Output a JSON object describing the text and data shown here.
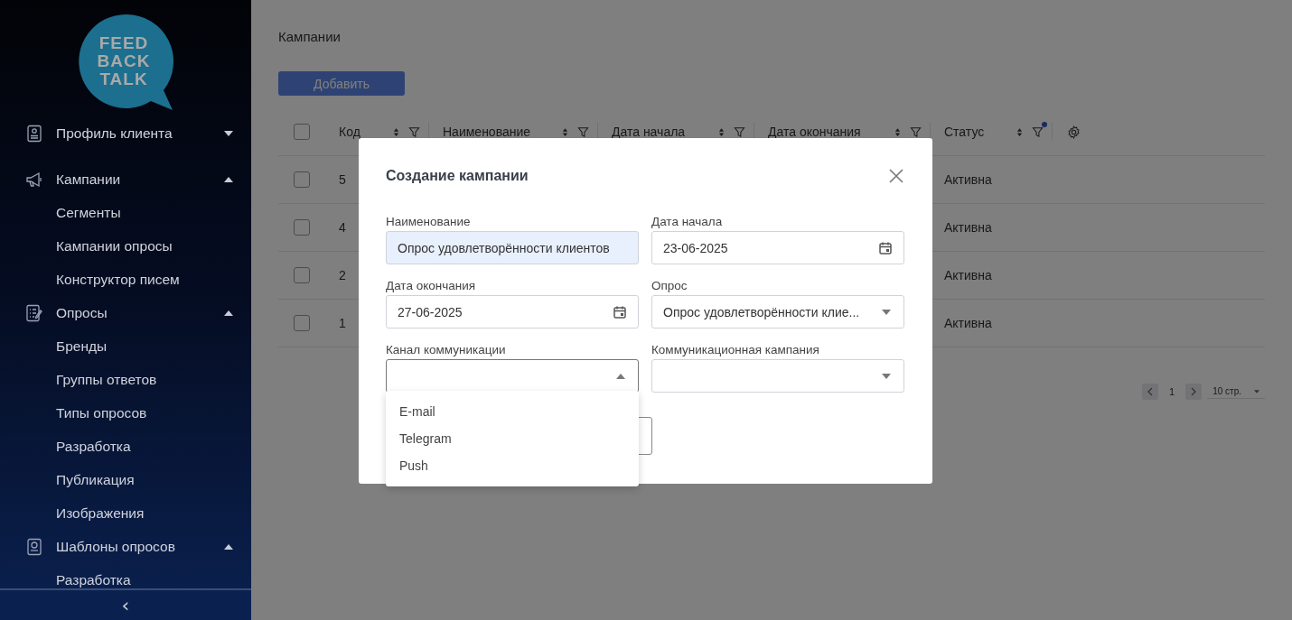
{
  "sidebar": {
    "logo": [
      "FEED",
      "BACK",
      "TALK"
    ],
    "menu": [
      {
        "label": "Профиль клиента",
        "expanded": false
      },
      {
        "label": "Кампании",
        "expanded": true,
        "children": [
          {
            "label": "Сегменты"
          },
          {
            "label": "Кампании опросы"
          },
          {
            "label": "Конструктор писем"
          }
        ]
      },
      {
        "label": "Опросы",
        "expanded": true,
        "children": [
          {
            "label": "Бренды"
          },
          {
            "label": "Группы ответов"
          },
          {
            "label": "Типы опросов"
          },
          {
            "label": "Разработка"
          },
          {
            "label": "Публикация"
          },
          {
            "label": "Изображения"
          }
        ]
      },
      {
        "label": "Шаблоны опросов",
        "expanded": true,
        "children": [
          {
            "label": "Разработка"
          }
        ]
      }
    ],
    "collapse": "‹"
  },
  "page": {
    "title": "Кампании",
    "add_button": "Добавить"
  },
  "table": {
    "all_checked": false,
    "columns": [
      {
        "label": "Код",
        "filtered": false
      },
      {
        "label": "Наименование",
        "filtered": false
      },
      {
        "label": "Дата начала",
        "filtered": false
      },
      {
        "label": "Дата окончания",
        "filtered": false
      },
      {
        "label": "Статус",
        "filtered": true
      }
    ],
    "rows": [
      {
        "code": "5",
        "status": "Активна",
        "checked": false
      },
      {
        "code": "4",
        "status": "Активна",
        "checked": false
      },
      {
        "code": "2",
        "status": "Активна",
        "checked": false
      },
      {
        "code": "1",
        "status": "Активна",
        "checked": false
      }
    ]
  },
  "pagination": {
    "page": "1",
    "page_size": "10 стр."
  },
  "modal": {
    "title": "Создание кампании",
    "fields": [
      {
        "label": "Наименование",
        "kind": "text",
        "value": "Опрос удовлетворённости клиентов",
        "autofilled": true
      },
      {
        "label": "Дата начала",
        "kind": "date",
        "value": "23-06-2025"
      },
      {
        "label": "Дата окончания",
        "kind": "date",
        "value": "27-06-2025"
      },
      {
        "label": "Опрос",
        "kind": "select",
        "value": "Опрос удовлетворённости клие...",
        "open": false
      },
      {
        "label": "Канал коммуникации",
        "kind": "select",
        "open": true,
        "options": [
          "E-mail",
          "Telegram",
          "Push"
        ]
      },
      {
        "label": "Коммуникационная кампания",
        "kind": "select",
        "open": false
      }
    ]
  }
}
